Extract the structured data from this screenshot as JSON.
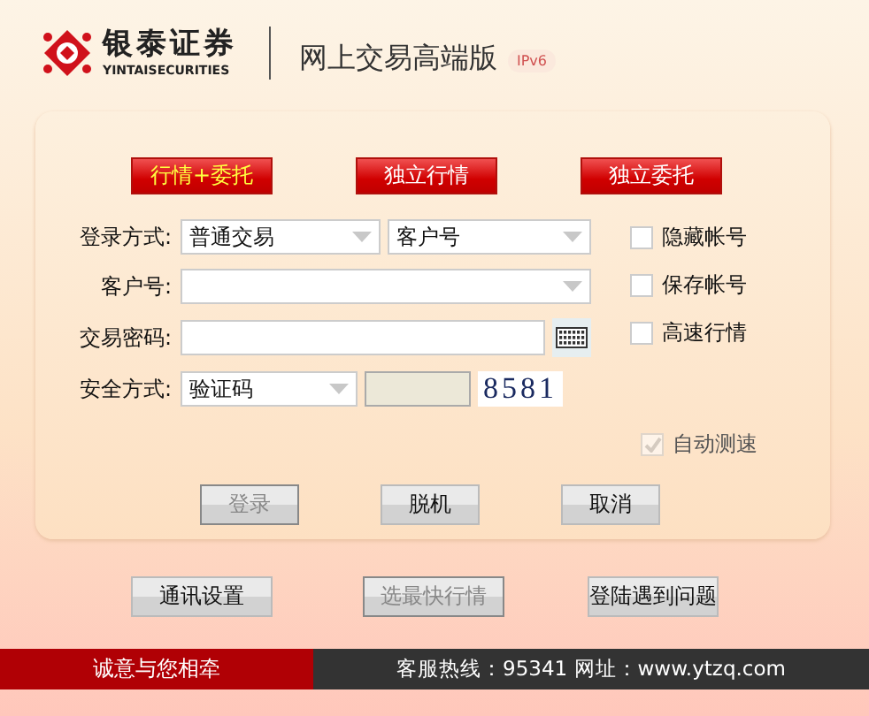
{
  "header": {
    "brand_name": "银泰证券",
    "brand_sub": "YINTAISECURITIES",
    "product": "网上交易高端版",
    "badge": "IPv6"
  },
  "modes": [
    {
      "label": "行情+委托",
      "selected": true
    },
    {
      "label": "独立行情",
      "selected": false
    },
    {
      "label": "独立委托",
      "selected": false
    }
  ],
  "form": {
    "login_label": "登录方式:",
    "login_type": "普通交易",
    "account_type": "客户号",
    "account_label": "客户号:",
    "password_label": "交易密码:",
    "security_label": "安全方式:",
    "security_type": "验证码",
    "captcha": "8581"
  },
  "options": [
    {
      "label": "隐藏帐号",
      "checked": false,
      "disabled": false
    },
    {
      "label": "保存帐号",
      "checked": false,
      "disabled": false
    },
    {
      "label": "高速行情",
      "checked": false,
      "disabled": false
    },
    {
      "label": "自动测速",
      "checked": true,
      "disabled": true
    }
  ],
  "actions": [
    {
      "label": "登录",
      "disabled": true
    },
    {
      "label": "脱机",
      "disabled": false
    },
    {
      "label": "取消",
      "disabled": false
    }
  ],
  "tools": [
    {
      "label": "通讯设置",
      "disabled": false
    },
    {
      "label": "选最快行情",
      "disabled": true
    },
    {
      "label": "登陆遇到问题",
      "disabled": false
    }
  ],
  "footer": {
    "slogan": "诚意与您相牵",
    "contact": "客服热线：95341 网址：www.ytzq.com"
  }
}
